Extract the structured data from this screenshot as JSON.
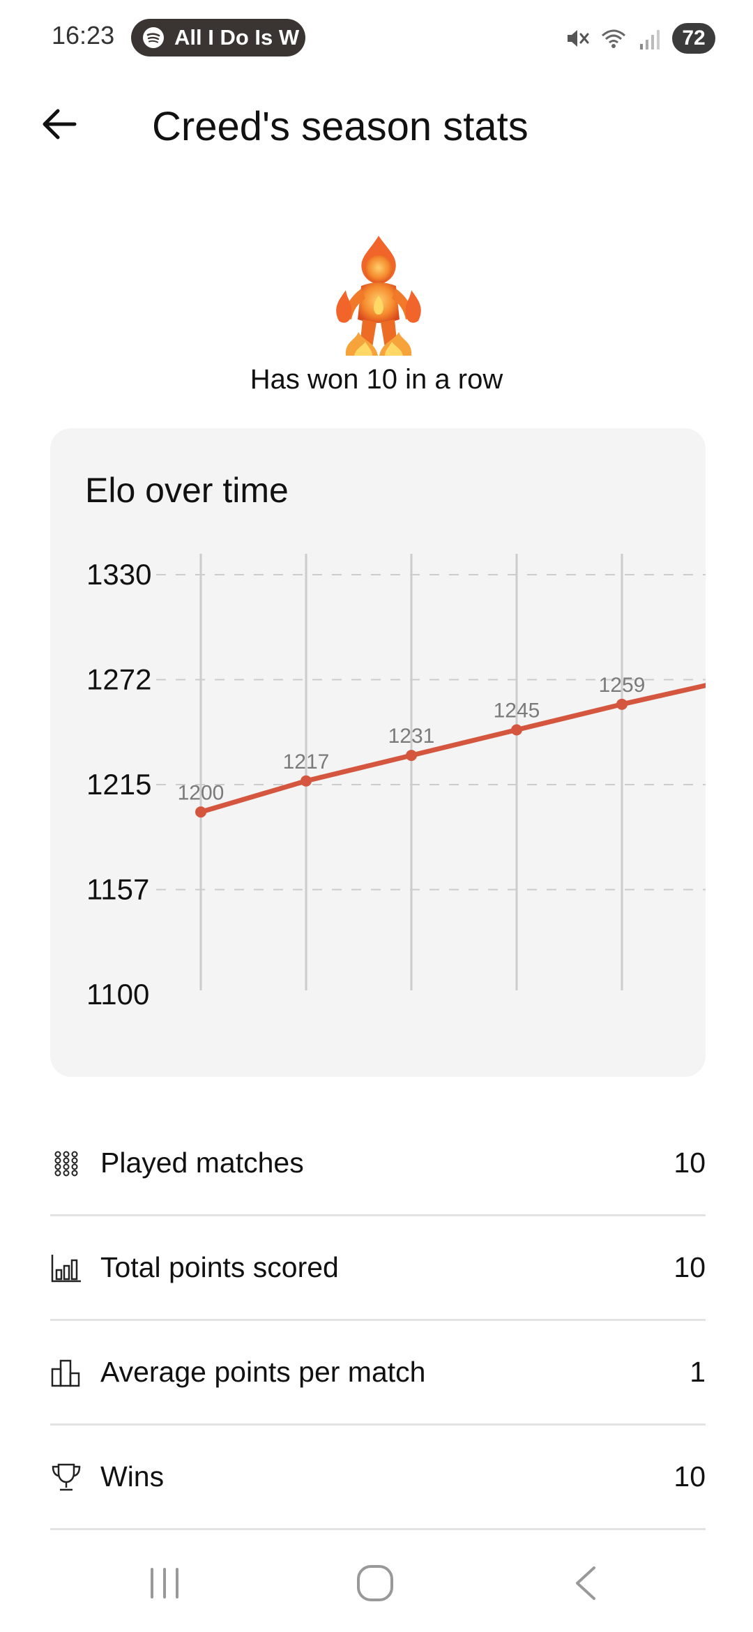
{
  "status_bar": {
    "time": "16:23",
    "media_title": "All I Do Is W",
    "battery": "72",
    "icons": [
      "mute-icon",
      "wifi-6e-icon",
      "signal-icon"
    ]
  },
  "header": {
    "title": "Creed's season stats",
    "back_icon": "arrow-left-icon"
  },
  "streak": {
    "icon": "fire-person-emoji",
    "text": "Has won 10 in a row"
  },
  "chart_data": {
    "type": "line",
    "title": "Elo over time",
    "y_ticks": [
      "1330",
      "1272",
      "1215",
      "1157",
      "1100"
    ],
    "ylim": [
      1100,
      1330
    ],
    "x": [
      1,
      2,
      3,
      4,
      5,
      6
    ],
    "series": [
      {
        "values": [
          1200,
          1217,
          1231,
          1245,
          1259,
          1272
        ]
      }
    ],
    "data_labels": [
      "1200",
      "1217",
      "1231",
      "1245",
      "1259"
    ],
    "grid": "horizontal-dashed, vertical-solid",
    "colors": {
      "line": "#d4563f",
      "grid": "#cccccc",
      "label": "#7a7a7a"
    }
  },
  "stats": [
    {
      "icon": "grid-dots-icon",
      "label": "Played matches",
      "value": "10"
    },
    {
      "icon": "bar-chart-icon",
      "label": "Total points scored",
      "value": "10"
    },
    {
      "icon": "bar-chart-outline-icon",
      "label": "Average points per match",
      "value": "1"
    },
    {
      "icon": "trophy-icon",
      "label": "Wins",
      "value": "10"
    }
  ],
  "nav": {
    "icons": [
      "recent-apps-icon",
      "home-icon",
      "back-icon"
    ]
  }
}
